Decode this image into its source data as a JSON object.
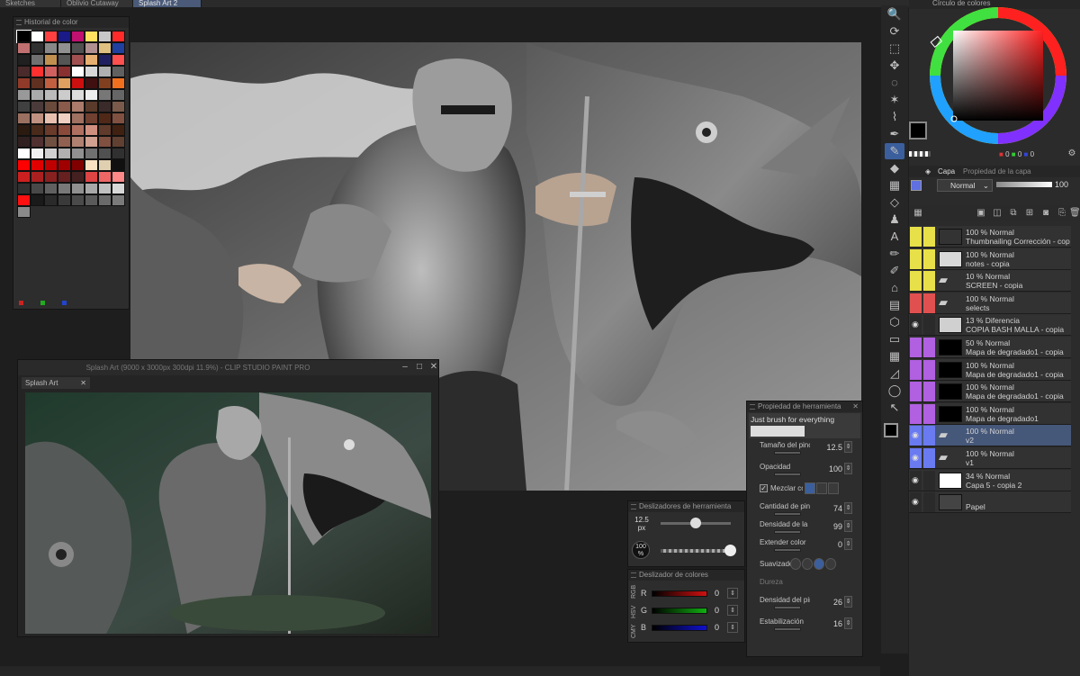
{
  "tabs": [
    "Sketches",
    "Oblivio Cutaway",
    "Splash Art 2"
  ],
  "color_history": {
    "title": "Historial de color",
    "swatches": [
      "#000000",
      "#ffffff",
      "#ff4040",
      "#1a1a88",
      "#c01070",
      "#ffe060",
      "#c8c8c8",
      "#ff2a2a",
      "#c07070",
      "#303030",
      "#888888",
      "#909090",
      "#505050",
      "#b09090",
      "#e0c080",
      "#2040a0",
      "#202020",
      "#707070",
      "#c09050",
      "#555555",
      "#a05050",
      "#e8b070",
      "#202060",
      "#ff5050",
      "#4a2a2a",
      "#ff3030",
      "#d06060",
      "#8a3030",
      "#ffffff",
      "#d8d8d8",
      "#b0b0b0",
      "#606060",
      "#903a2a",
      "#603020",
      "#c06040",
      "#e0a060",
      "#cc1010",
      "#401010",
      "#804020",
      "#f07020",
      "#999999",
      "#aaaaaa",
      "#bbbbbb",
      "#cccccc",
      "#dddddd",
      "#eeeeee",
      "#777777",
      "#666666",
      "#404040",
      "#4a3a3a",
      "#6a4a3a",
      "#8a5a4a",
      "#aa7a6a",
      "#5a3a2a",
      "#3a2a2a",
      "#7a5a4a",
      "#9a7060",
      "#c09080",
      "#e8c0b0",
      "#f0d0c0",
      "#a07060",
      "#704030",
      "#502818",
      "#805040",
      "#2a1a10",
      "#4a2a1a",
      "#6a3a2a",
      "#8a4a3a",
      "#b07060",
      "#d09080",
      "#603a2a",
      "#402010",
      "#302020",
      "#503030",
      "#705040",
      "#906050",
      "#b08070",
      "#d0a090",
      "#805040",
      "#604030",
      "#ffffff",
      "#f0f0f0",
      "#d0d0d0",
      "#b0b0b0",
      "#909090",
      "#707070",
      "#505050",
      "#303030",
      "#ff0000",
      "#e00000",
      "#c00000",
      "#a00000",
      "#800000",
      "#f8e0c0",
      "#e0d0b0",
      "#101010",
      "#cc2020",
      "#aa2020",
      "#882020",
      "#662020",
      "#442020",
      "#dd4444",
      "#ee6666",
      "#ff8888",
      "#303030",
      "#484848",
      "#606060",
      "#787878",
      "#909090",
      "#a8a8a8",
      "#c0c0c0",
      "#d8d8d8",
      "#ff1010",
      "#1a1a1a",
      "#2a2a2a",
      "#3a3a3a",
      "#4a4a4a",
      "#5a5a5a",
      "#6a6a6a",
      "#7a7a7a",
      "#8a8a8a"
    ],
    "dots": [
      "#cc2222",
      "#22aa22",
      "#2244cc"
    ]
  },
  "doc_window": {
    "title": "Splash Art (9000 x 3000px 300dpi 11.9%)  - CLIP STUDIO PAINT PRO",
    "tab": "Splash Art"
  },
  "tool_sliders": {
    "title": "Deslizadores de herramienta",
    "size_value": "12.5",
    "size_unit": "px",
    "opacity_value": "100",
    "opacity_unit": "%",
    "size_fraction": 0.5,
    "opacity_fraction": 1.0
  },
  "color_sliders": {
    "title": "Deslizador de colores",
    "modes": [
      "RGB",
      "HSV",
      "CMY"
    ],
    "channels": [
      {
        "label": "R",
        "value": "0",
        "color": "#d01010"
      },
      {
        "label": "G",
        "value": "0",
        "color": "#10b010"
      },
      {
        "label": "B",
        "value": "0",
        "color": "#1010d0"
      }
    ]
  },
  "tool_property": {
    "title": "Propiedad de herramienta",
    "brush_name": "Just brush for everything",
    "brush_size_label": "Tamaño del pincel",
    "brush_size_value": "12.5",
    "opacity_label": "Opacidad",
    "opacity_value": "100",
    "blend_label": "Mezclar colores",
    "paint_amount_label": "Cantidad de pintura",
    "paint_amount_value": "74",
    "paint_density_label": "Densidad de la pintura",
    "paint_density_value": "99",
    "stretch_label": "Extender color",
    "stretch_value": "0",
    "smoothing_label": "Suavizado",
    "hardness_label": "Dureza",
    "brush_density_label": "Densidad del pincel",
    "brush_density_value": "26",
    "stabilization_label": "Estabilización",
    "stabilization_value": "16"
  },
  "color_wheel": {
    "title": "Círculo de colores",
    "main_color": "#000000",
    "sub_color": "#ffffff",
    "rgb_values": [
      "0",
      "0",
      "0"
    ]
  },
  "layer_panel": {
    "tabs": [
      "Capa",
      "Propiedad de la capa"
    ],
    "blend_mode": "Normal",
    "opacity": "100",
    "layers": [
      {
        "opacity_mode": "100 % Normal",
        "name": "Thumbnailing Corrección - copia",
        "color": "#e8e048",
        "thumb": "#333333"
      },
      {
        "opacity_mode": "100 % Normal",
        "name": "notes - copia",
        "color": "#e8e048",
        "thumb": "#d8d8d8"
      },
      {
        "opacity_mode": "10 % Normal",
        "name": "SCREEN - copia",
        "color": "#e8e048",
        "thumb": "folder"
      },
      {
        "opacity_mode": "100 % Normal",
        "name": "selects",
        "color": "#e05050",
        "thumb": "folder"
      },
      {
        "opacity_mode": "13 % Diferencia",
        "name": "COPIA BASH MALLA - copia",
        "color": "#2a2a2a",
        "thumb": "#d0d0d0"
      },
      {
        "opacity_mode": "50 % Normal",
        "name": "Mapa de degradado1 - copia",
        "color": "#b060e0",
        "thumb": "#000000"
      },
      {
        "opacity_mode": "100 % Normal",
        "name": "Mapa de degradado1 - copia",
        "color": "#b060e0",
        "thumb": "#000000"
      },
      {
        "opacity_mode": "100 % Normal",
        "name": "Mapa de degradado1 - copia",
        "color": "#b060e0",
        "thumb": "#000000"
      },
      {
        "opacity_mode": "100 % Normal",
        "name": "Mapa de degradado1",
        "color": "#b060e0",
        "thumb": "#000000"
      },
      {
        "opacity_mode": "100 % Normal",
        "name": "v2",
        "color": "#6a7af0",
        "thumb": "folder"
      },
      {
        "opacity_mode": "100 % Normal",
        "name": "v1",
        "color": "#6a7af0",
        "thumb": "folder"
      },
      {
        "opacity_mode": "34 % Normal",
        "name": "Capa 5 - copia 2",
        "color": "#2a2a2a",
        "thumb": "#ffffff"
      },
      {
        "opacity_mode": "",
        "name": "Papel",
        "color": "#2a2a2a",
        "thumb": "#444444"
      }
    ]
  },
  "tools": [
    "zoom-icon",
    "rotate-icon",
    "object-icon",
    "move-icon",
    "lasso-icon",
    "magic-wand-icon",
    "eyedropper-icon",
    "pen-icon",
    "brush-icon",
    "fill-icon",
    "grid-icon",
    "eraser-icon",
    "stamp-icon",
    "text-icon",
    "pencil-icon",
    "marker-icon",
    "airbrush-icon",
    "ruler-icon",
    "blend-icon",
    "figure-icon",
    "frame-icon",
    "vector-icon",
    "balloon-icon",
    "correction-icon"
  ]
}
